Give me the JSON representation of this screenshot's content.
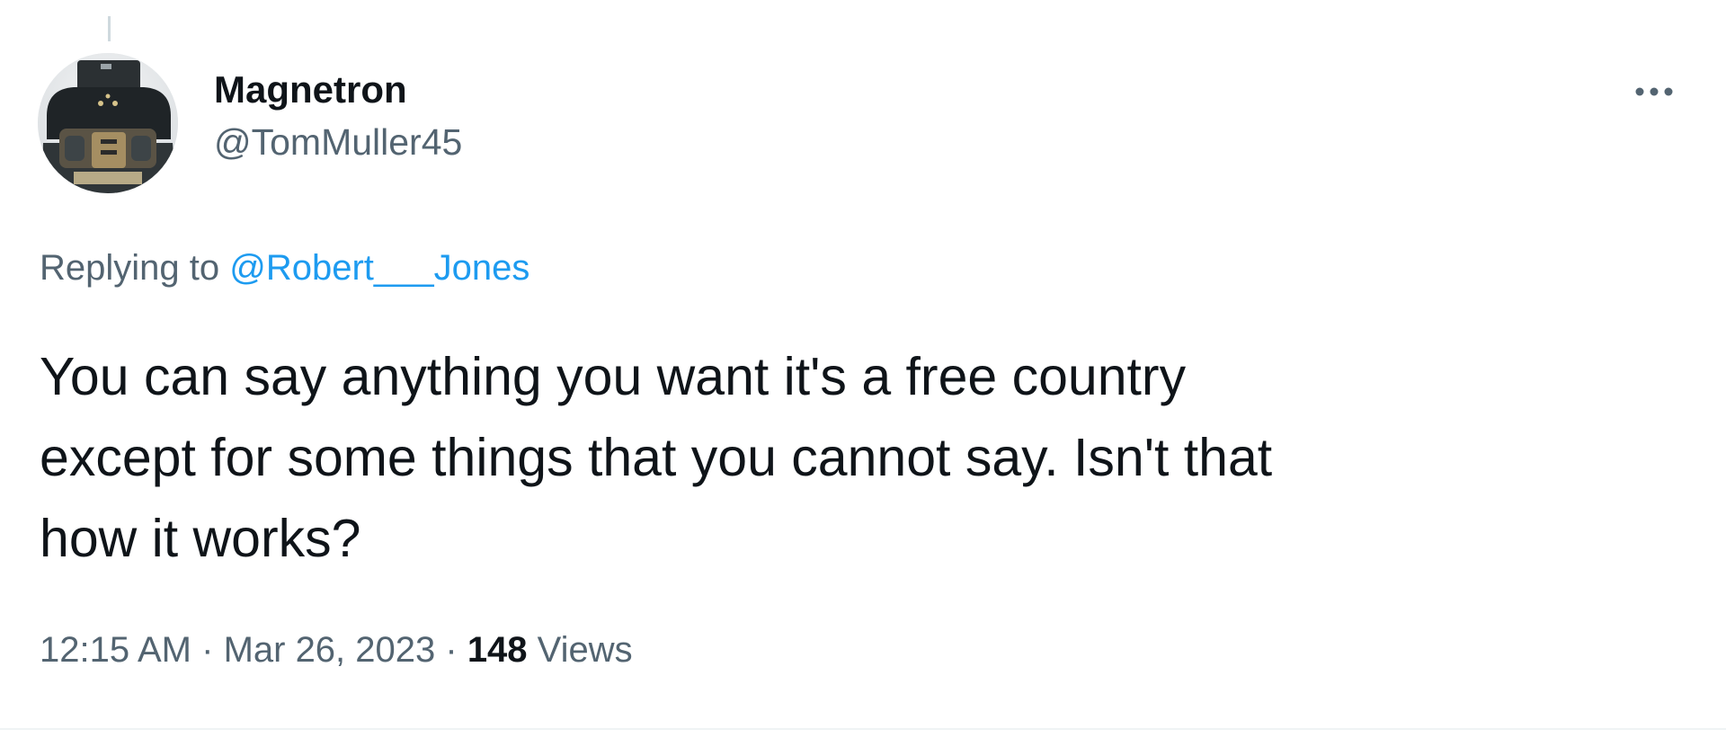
{
  "tweet": {
    "author": {
      "display_name": "Magnetron",
      "handle": "@TomMuller45",
      "avatar_icon": "helmet-avatar-icon"
    },
    "more_icon": "more-horizontal-icon",
    "replying_prefix": "Replying to ",
    "replying_to": "@Robert___Jones",
    "text": "You can say anything you want it's a free country\nexcept for some things that you cannot say. Isn't that\nhow it works?",
    "time": "12:15 AM",
    "separator": " · ",
    "date": "Mar 26, 2023",
    "views_count": "148",
    "views_label": " Views"
  },
  "colors": {
    "text_primary": "#0f1419",
    "text_secondary": "#536471",
    "link": "#1d9bf0",
    "divider": "#eff3f4"
  }
}
